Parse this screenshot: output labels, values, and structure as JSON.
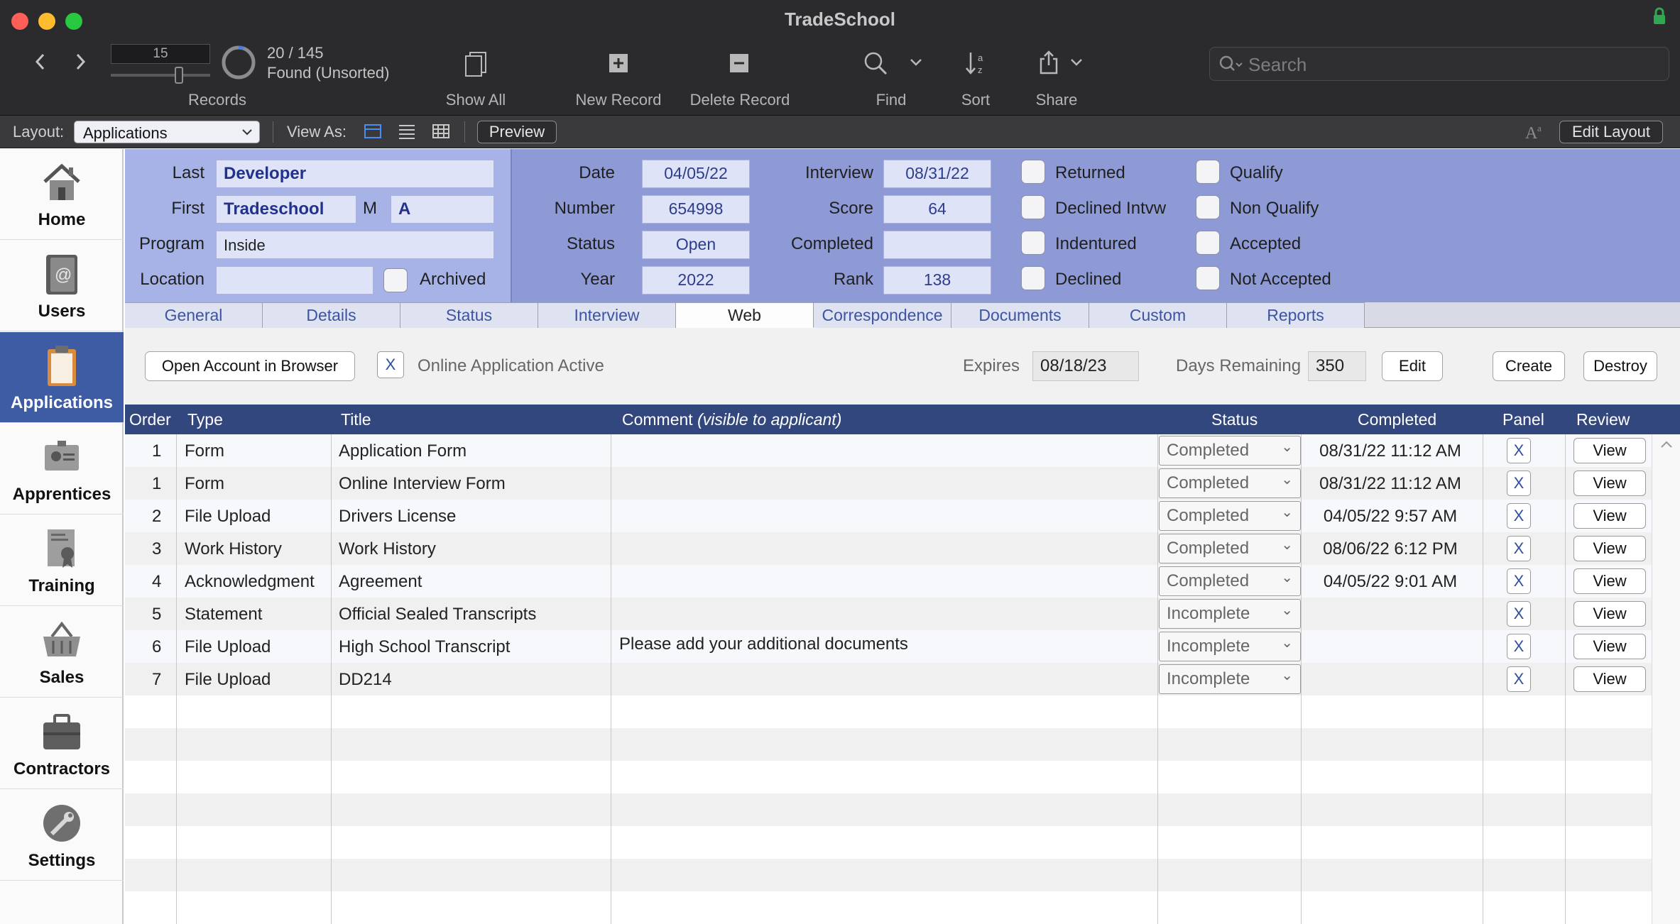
{
  "window": {
    "title": "TradeSchool"
  },
  "toolbar": {
    "record_slider_value": "15",
    "record_counter": "20 / 145",
    "found_status": "Found (Unsorted)",
    "records_label": "Records",
    "show_all_label": "Show All",
    "new_record_label": "New Record",
    "delete_record_label": "Delete Record",
    "find_label": "Find",
    "sort_label": "Sort",
    "share_label": "Share",
    "search_placeholder": "Search"
  },
  "layout_bar": {
    "layout_label": "Layout:",
    "layout_value": "Applications",
    "view_as_label": "View As:",
    "preview_label": "Preview",
    "edit_layout_label": "Edit Layout"
  },
  "sidebar": {
    "items": [
      {
        "label": "Home",
        "icon": "house-icon"
      },
      {
        "label": "Users",
        "icon": "address-book-icon"
      },
      {
        "label": "Applications",
        "icon": "clipboard-icon",
        "active": true
      },
      {
        "label": "Apprentices",
        "icon": "id-badge-icon"
      },
      {
        "label": "Training",
        "icon": "certificate-icon"
      },
      {
        "label": "Sales",
        "icon": "basket-icon"
      },
      {
        "label": "Contractors",
        "icon": "briefcase-icon"
      },
      {
        "label": "Settings",
        "icon": "wrench-icon"
      }
    ]
  },
  "record": {
    "last_label": "Last",
    "last": "Developer",
    "first_label": "First",
    "first": "Tradeschool",
    "middle_label": "M",
    "middle": "A",
    "program_label": "Program",
    "program": "Inside",
    "location_label": "Location",
    "location": "",
    "archived_label": "Archived",
    "date_label": "Date",
    "date": "04/05/22",
    "number_label": "Number",
    "number": "654998",
    "status_label": "Status",
    "status": "Open",
    "year_label": "Year",
    "year": "2022",
    "interview_label": "Interview",
    "interview": "08/31/22",
    "score_label": "Score",
    "score": "64",
    "completed_label": "Completed",
    "completed": "",
    "rank_label": "Rank",
    "rank": "138",
    "checkboxes_col1": [
      "Returned",
      "Declined Intvw",
      "Indentured",
      "Declined"
    ],
    "checkboxes_col2": [
      "Qualify",
      "Non Qualify",
      "Accepted",
      "Not Accepted"
    ]
  },
  "tabs": [
    "General",
    "Details",
    "Status",
    "Interview",
    "Web",
    "Correspondence",
    "Documents",
    "Custom",
    "Reports"
  ],
  "active_tab": "Web",
  "web_panel": {
    "open_account_label": "Open Account in Browser",
    "online_active_mark": "X",
    "online_active_label": "Online Application Active",
    "expires_label": "Expires",
    "expires": "08/18/23",
    "days_remaining_label": "Days Remaining",
    "days_remaining": "350",
    "edit_label": "Edit",
    "create_label": "Create",
    "destroy_label": "Destroy"
  },
  "table": {
    "headers": {
      "order": "Order",
      "type": "Type",
      "title": "Title",
      "comment": "Comment",
      "comment_note": "(visible to applicant)",
      "status": "Status",
      "completed": "Completed",
      "panel": "Panel",
      "review": "Review"
    },
    "rows": [
      {
        "order": "1",
        "type": "Form",
        "title": "Application Form",
        "comment": "",
        "status": "Completed",
        "completed": "08/31/22 11:12 AM",
        "panel": "X",
        "review": "View"
      },
      {
        "order": "1",
        "type": "Form",
        "title": "Online Interview Form",
        "comment": "",
        "status": "Completed",
        "completed": "08/31/22 11:12 AM",
        "panel": "X",
        "review": "View"
      },
      {
        "order": "2",
        "type": "File Upload",
        "title": "Drivers License",
        "comment": "",
        "status": "Completed",
        "completed": "04/05/22 9:57 AM",
        "panel": "X",
        "review": "View"
      },
      {
        "order": "3",
        "type": "Work History",
        "title": "Work History",
        "comment": "",
        "status": "Completed",
        "completed": "08/06/22 6:12 PM",
        "panel": "X",
        "review": "View"
      },
      {
        "order": "4",
        "type": "Acknowledgment",
        "title": "Agreement",
        "comment": "",
        "status": "Completed",
        "completed": "04/05/22 9:01 AM",
        "panel": "X",
        "review": "View"
      },
      {
        "order": "5",
        "type": "Statement",
        "title": "Official Sealed Transcripts",
        "comment": "",
        "status": "Incomplete",
        "completed": "",
        "panel": "X",
        "review": "View"
      },
      {
        "order": "6",
        "type": "File Upload",
        "title": "High School Transcript",
        "comment": "Please add your additional documents",
        "status": "Incomplete",
        "completed": "",
        "panel": "X",
        "review": "View"
      },
      {
        "order": "7",
        "type": "File Upload",
        "title": "DD214",
        "comment": "",
        "status": "Incomplete",
        "completed": "",
        "panel": "X",
        "review": "View"
      }
    ]
  },
  "colors": {
    "accent": "#3e5ca4",
    "header_bg": "#8d9ad5",
    "table_header": "#33477f"
  }
}
